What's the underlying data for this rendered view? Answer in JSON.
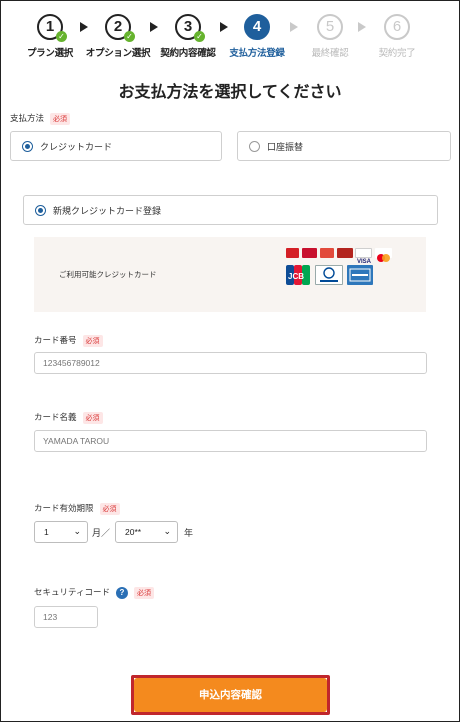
{
  "stepper": {
    "steps": [
      {
        "number": "1",
        "label": "プラン選択"
      },
      {
        "number": "2",
        "label": "オプション選択"
      },
      {
        "number": "3",
        "label": "契約内容確認"
      },
      {
        "number": "4",
        "label": "支払方法登録"
      },
      {
        "number": "5",
        "label": "最終確認"
      },
      {
        "number": "6",
        "label": "契約完了"
      }
    ]
  },
  "page_title": "お支払方法を選択してください",
  "required_badge": "必須",
  "payment": {
    "label": "支払方法",
    "options": [
      {
        "label": "クレジットカード",
        "selected": true
      },
      {
        "label": "口座振替",
        "selected": false
      }
    ]
  },
  "new_card": {
    "label": "新規クレジットカード登録",
    "selected": true
  },
  "available_cards": {
    "label": "ご利用可能クレジットカード",
    "logo_names": [
      "saison-icon",
      "dc-icon",
      "nicos-icon",
      "uc-icon",
      "visa-icon",
      "mastercard-icon",
      "jcb-icon",
      "diners-club-icon",
      "american-express-icon"
    ]
  },
  "card_number": {
    "label": "カード番号",
    "placeholder": "123456789012"
  },
  "card_name": {
    "label": "カード名義",
    "placeholder": "YAMADA TAROU"
  },
  "expiry": {
    "label": "カード有効期限",
    "month_value": "1",
    "month_unit": "月／",
    "year_value": "20**",
    "year_unit": "年"
  },
  "security_code": {
    "label": "セキュリティコード",
    "help": "?",
    "placeholder": "123"
  },
  "submit_label": "申込内容確認",
  "colors": {
    "active_step": "#1f5f9c",
    "done_check": "#66b32e",
    "cta": "#f48a1e",
    "cta_highlight": "#c0262c",
    "required": "#d93636"
  }
}
